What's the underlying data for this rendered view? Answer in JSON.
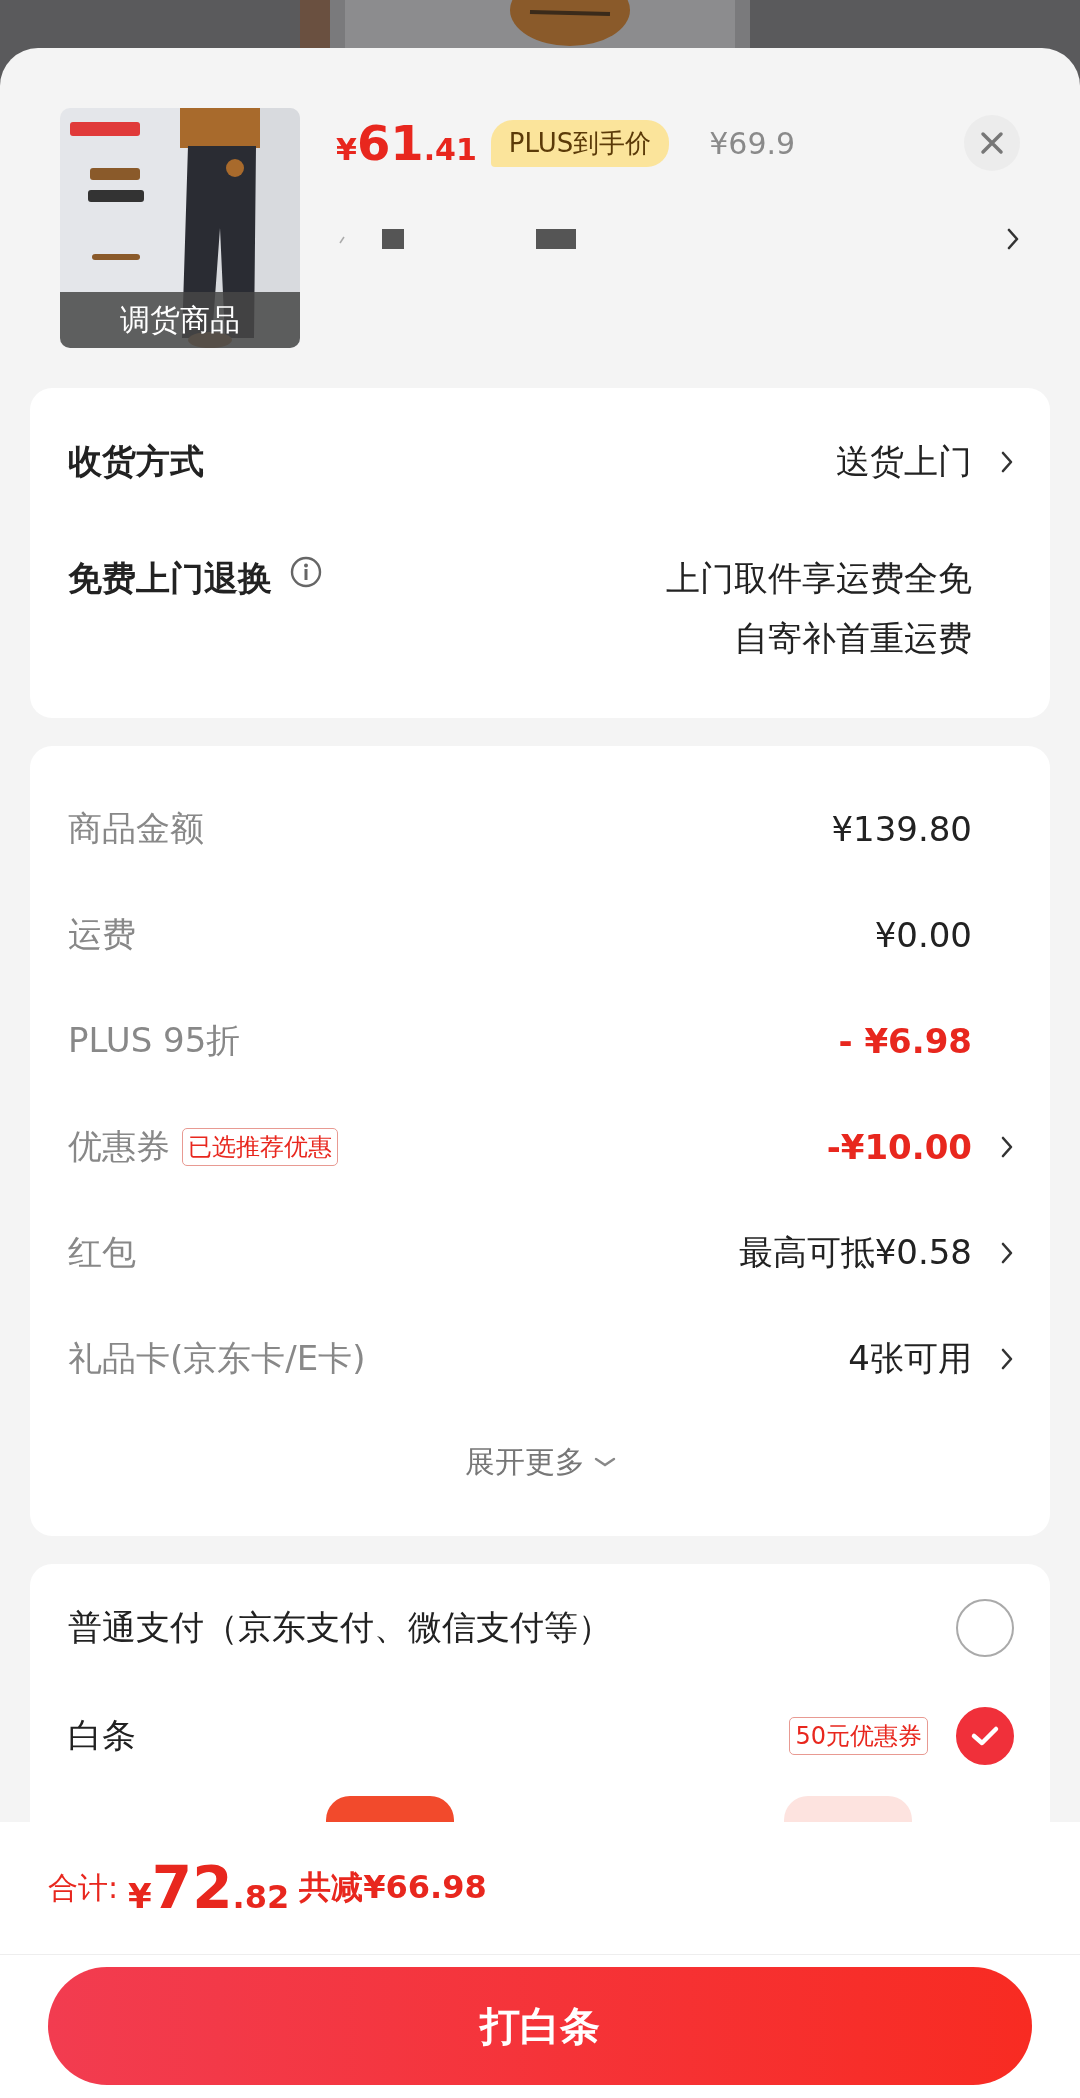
{
  "product": {
    "image": {
      "kind": "picture",
      "label": "调货商品"
    },
    "price_main": "61",
    "price_decimal": ".41",
    "price_currency": "¥",
    "price_badge": "PLUS到手价",
    "original_price": "¥69.9"
  },
  "delivery": [
    {
      "label": "收货方式",
      "value": [
        "送货上门"
      ],
      "chevron": true,
      "info": false
    },
    {
      "label": "免费上门退换",
      "value": [
        "上门取件享运费全免",
        "自寄补首重运费"
      ],
      "chevron": false,
      "info": true
    }
  ],
  "costs": [
    {
      "label": "商品金额",
      "value": "¥139.80",
      "discount": false,
      "chevron": false
    },
    {
      "label": "运费",
      "value": "¥0.00",
      "discount": false,
      "chevron": false
    },
    {
      "label": "PLUS 95折",
      "value": "- ¥6.98",
      "discount": true,
      "chevron": false
    },
    {
      "label": "优惠券",
      "tag": "已选推荐优惠",
      "value": "-¥10.00",
      "discount": true,
      "chevron": true
    },
    {
      "label": "红包",
      "value": "最高可抵¥0.58",
      "discount": false,
      "chevron": true
    },
    {
      "label": "礼品卡(京东卡/E卡)",
      "value": "4张可用",
      "discount": false,
      "chevron": true
    }
  ],
  "expand_more": "展开更多",
  "payment": [
    {
      "label": "普通支付（京东支付、微信支付等）",
      "selected": false
    },
    {
      "label": "白条",
      "tag": "50元优惠券",
      "selected": true
    }
  ],
  "promo_tags": [
    {
      "highlighted": true
    },
    {
      "highlighted": false
    }
  ],
  "footer": {
    "total_label": "合计:",
    "currency": "¥",
    "total_main": "72",
    "total_decimal": ".82",
    "savings": "共减¥66.98",
    "button": "打白条"
  }
}
